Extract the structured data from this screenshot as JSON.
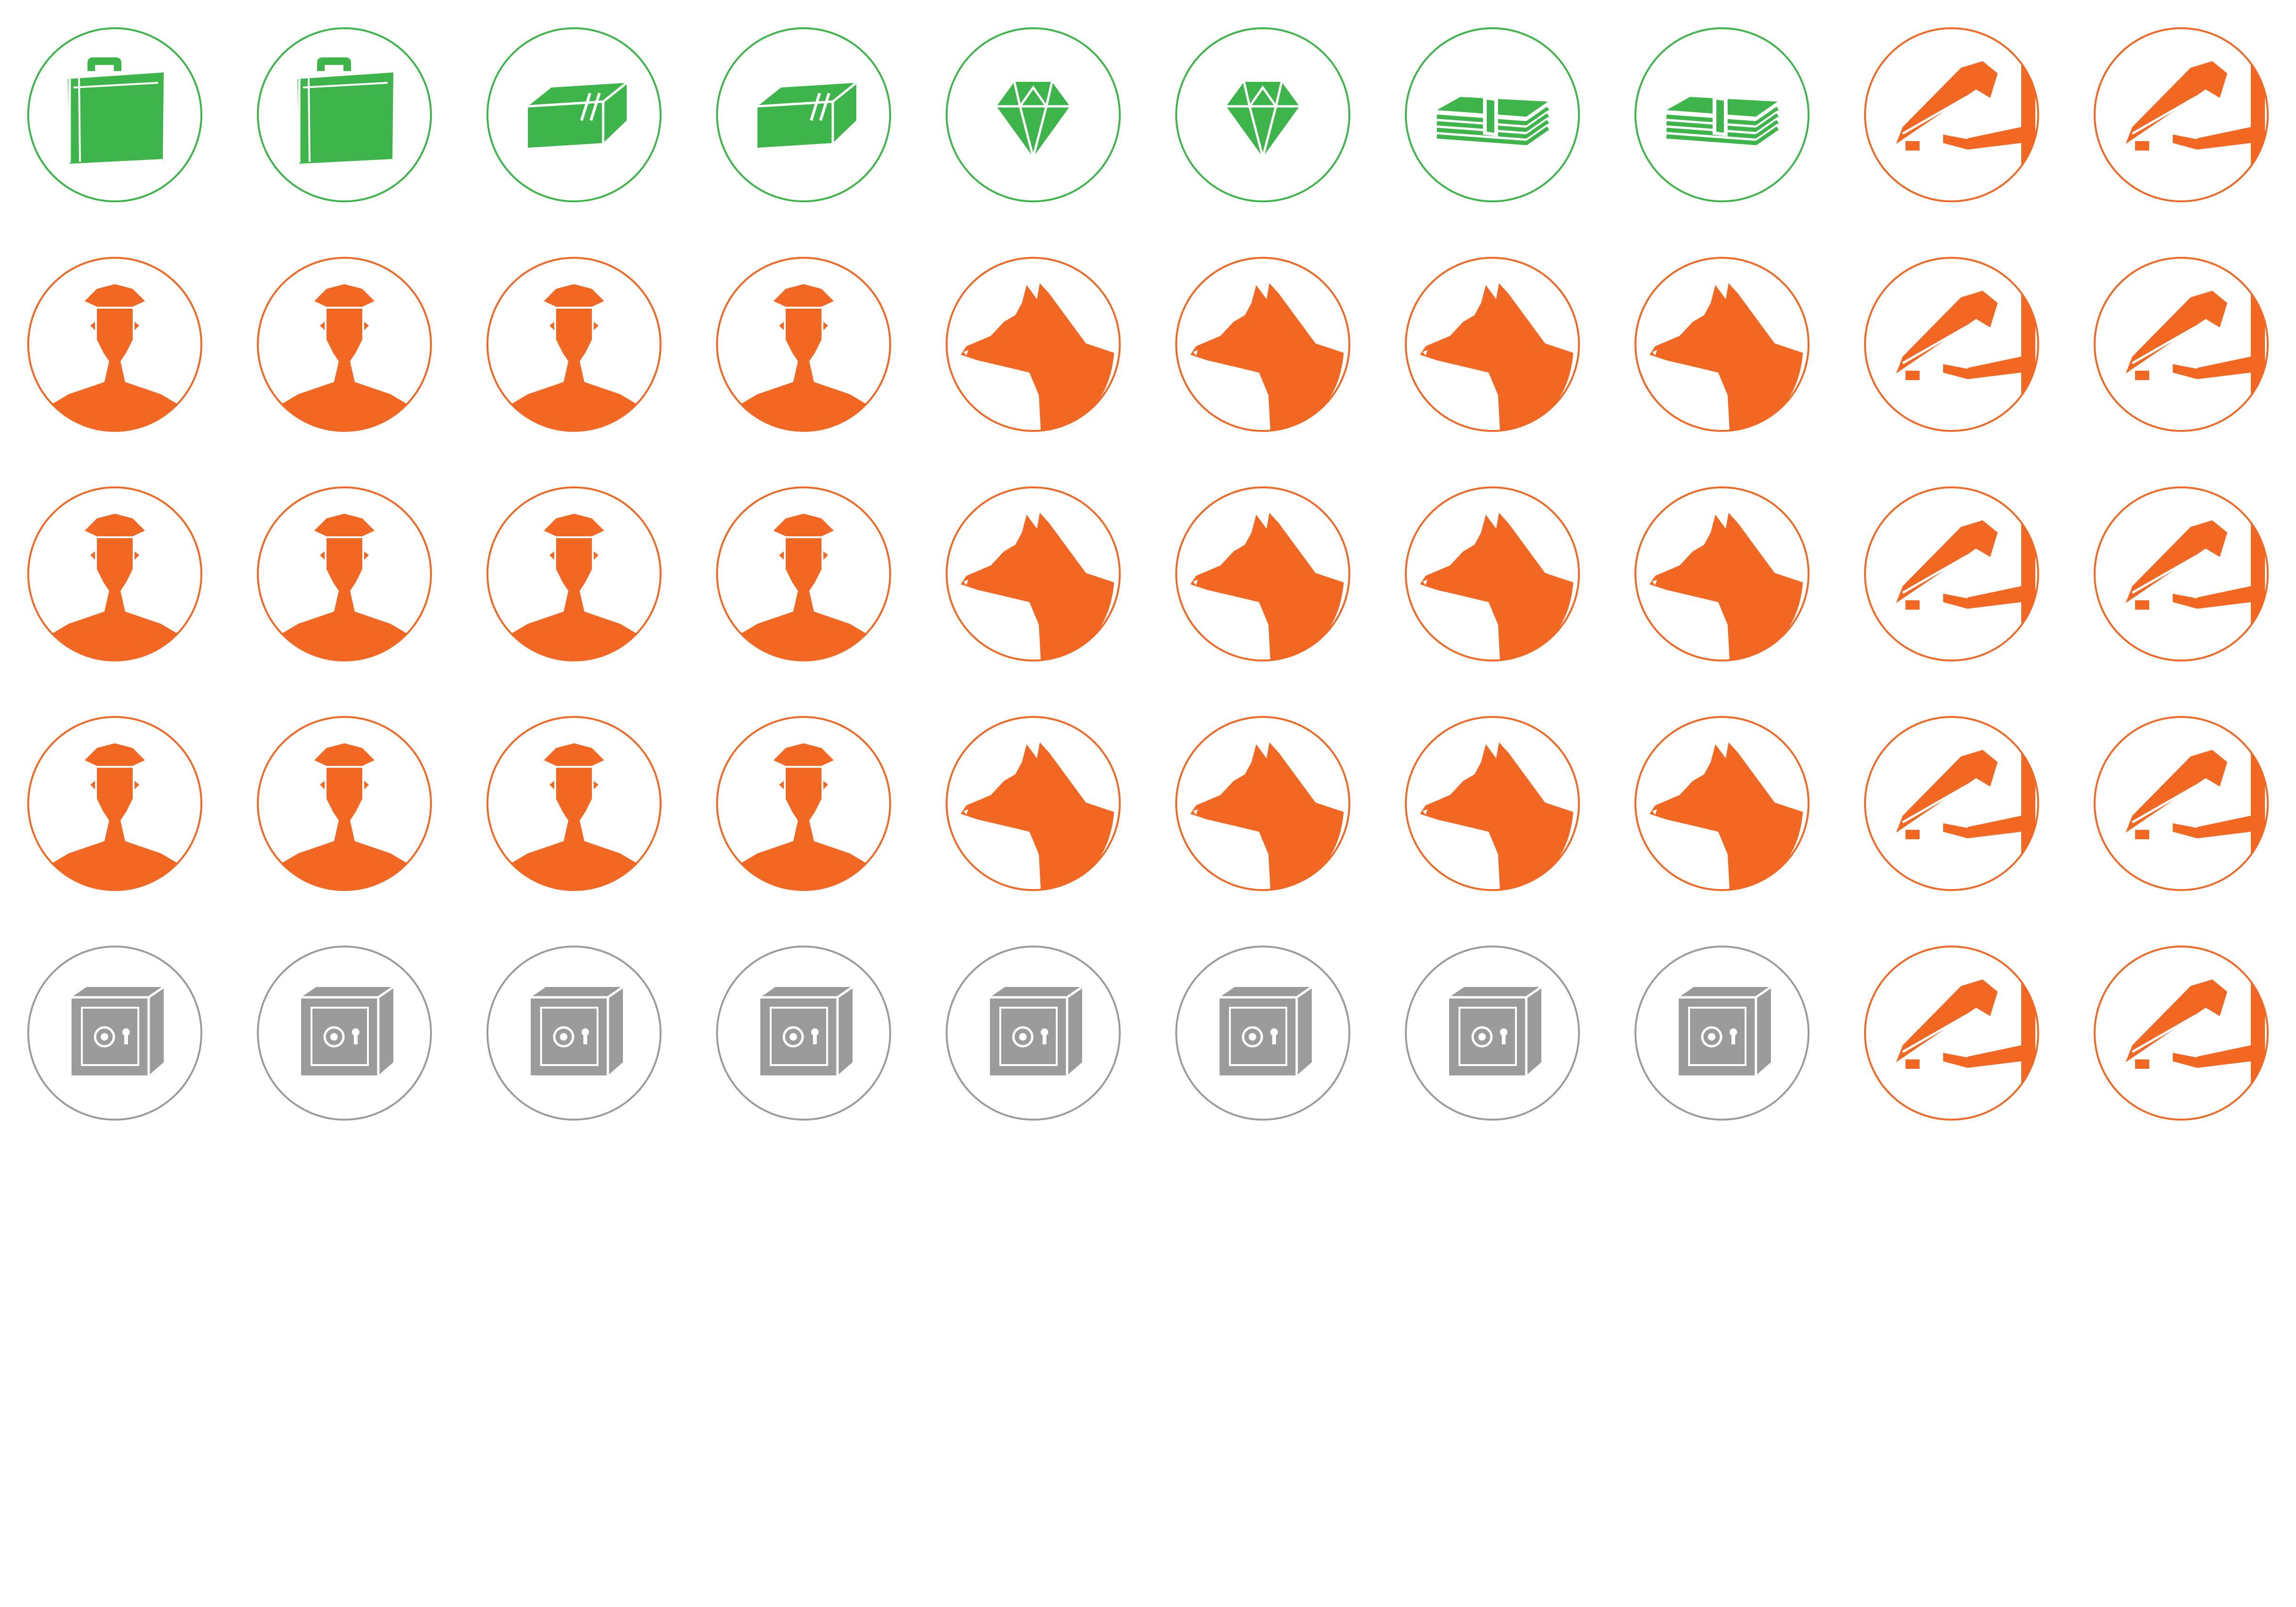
{
  "palette": {
    "loot": "#3db54a",
    "guard": "#f26722",
    "safe": "#9b9b9b",
    "background": "#ffffff"
  },
  "token_sheet": {
    "rows": [
      [
        "briefcase-icon",
        "briefcase-icon",
        "gold-bar-icon",
        "gold-bar-icon",
        "diamond-icon",
        "diamond-icon",
        "cash-stack-icon",
        "cash-stack-icon",
        "security-camera-icon",
        "security-camera-icon"
      ],
      [
        "guard-icon",
        "guard-icon",
        "guard-icon",
        "guard-icon",
        "guard-dog-icon",
        "guard-dog-icon",
        "guard-dog-icon",
        "guard-dog-icon",
        "security-camera-icon",
        "security-camera-icon"
      ],
      [
        "guard-icon",
        "guard-icon",
        "guard-icon",
        "guard-icon",
        "guard-dog-icon",
        "guard-dog-icon",
        "guard-dog-icon",
        "guard-dog-icon",
        "security-camera-icon",
        "security-camera-icon"
      ],
      [
        "guard-icon",
        "guard-icon",
        "guard-icon",
        "guard-icon",
        "guard-dog-icon",
        "guard-dog-icon",
        "guard-dog-icon",
        "guard-dog-icon",
        "security-camera-icon",
        "security-camera-icon"
      ],
      [
        "safe-icon",
        "safe-icon",
        "safe-icon",
        "safe-icon",
        "safe-icon",
        "safe-icon",
        "safe-icon",
        "safe-icon",
        "security-camera-icon",
        "security-camera-icon"
      ]
    ],
    "icon_colors": {
      "briefcase-icon": "loot",
      "gold-bar-icon": "loot",
      "diamond-icon": "loot",
      "cash-stack-icon": "loot",
      "security-camera-icon": "guard",
      "guard-icon": "guard",
      "guard-dog-icon": "guard",
      "safe-icon": "safe"
    }
  }
}
